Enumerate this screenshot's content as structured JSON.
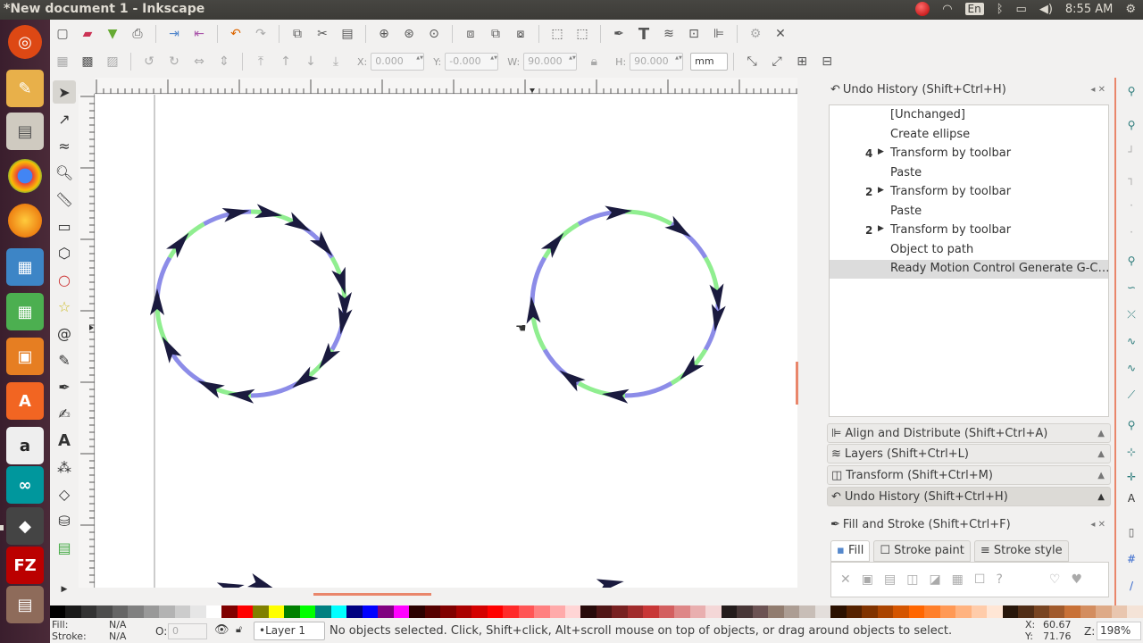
{
  "window": {
    "title": "*New document 1 - Inkscape"
  },
  "tray": {
    "lang": "En",
    "time": "8:55 AM"
  },
  "controls": {
    "x_label": "X:",
    "x_value": "0.000",
    "y_label": "Y:",
    "y_value": "-0.000",
    "w_label": "W:",
    "w_value": "90.000",
    "h_label": "H:",
    "h_value": "90.000",
    "unit": "mm"
  },
  "undo_history": {
    "title": "Undo History (Shift+Ctrl+H)",
    "rows": [
      {
        "count": "",
        "label": "[Unchanged]"
      },
      {
        "count": "",
        "label": "Create ellipse"
      },
      {
        "count": "4",
        "label": "Transform by toolbar"
      },
      {
        "count": "",
        "label": "Paste"
      },
      {
        "count": "2",
        "label": "Transform by toolbar"
      },
      {
        "count": "",
        "label": "Paste"
      },
      {
        "count": "2",
        "label": "Transform by toolbar"
      },
      {
        "count": "",
        "label": "Object to path"
      },
      {
        "count": "",
        "label": "Ready Motion Control Generate G-C…"
      }
    ]
  },
  "docked_panels": [
    "Align and Distribute (Shift+Ctrl+A)",
    "Layers (Shift+Ctrl+L)",
    "Transform (Shift+Ctrl+M)",
    "Undo History (Shift+Ctrl+H)"
  ],
  "fill_stroke": {
    "title": "Fill and Stroke (Shift+Ctrl+F)",
    "tabs": [
      "Fill",
      "Stroke paint",
      "Stroke style"
    ]
  },
  "status": {
    "fill_label": "Fill:",
    "fill_value": "N/A",
    "stroke_label": "Stroke:",
    "stroke_value": "N/A",
    "opacity_label": "O:",
    "opacity_value": "0",
    "layer": "•Layer 1",
    "message": "No objects selected. Click, Shift+click, Alt+scroll mouse on top of objects, or drag around objects to select.",
    "x_label": "X:",
    "x_value": "60.67",
    "y_label": "Y:",
    "y_value": "71.76",
    "zoom_label": "Z:",
    "zoom_value": "198%"
  },
  "colors": {
    "accent": "#e9866b",
    "arrow": "#1a1a3e",
    "stroke_blue": "#8c8ce8",
    "stroke_green": "#90ee90"
  }
}
